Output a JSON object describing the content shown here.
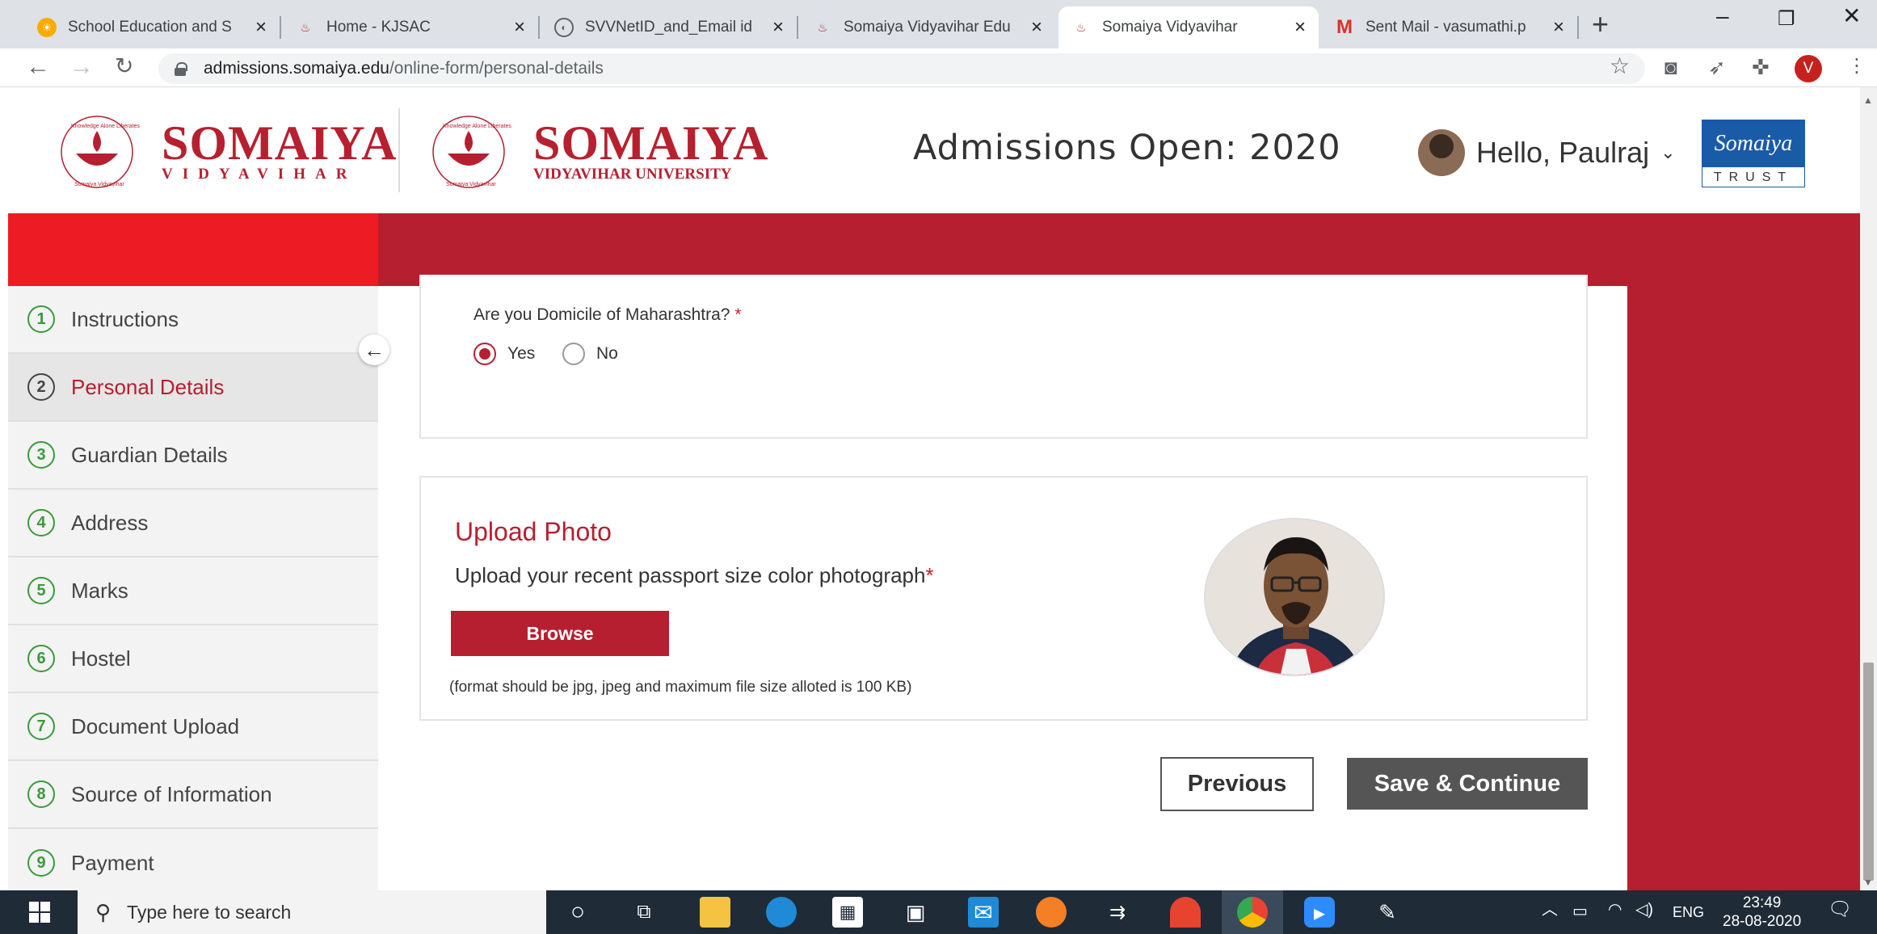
{
  "browser": {
    "tabs": [
      {
        "label": "School Education and S",
        "icon": "sun-favicon-icon",
        "color": "#f9ab00"
      },
      {
        "label": "Home - KJSAC",
        "icon": "somaiya-favicon-icon",
        "color": "#b61f30"
      },
      {
        "label": "SVVNetID_and_Email id",
        "icon": "globe-favicon-icon",
        "color": "#5f6368"
      },
      {
        "label": "Somaiya Vidyavihar Edu",
        "icon": "somaiya-favicon-icon",
        "color": "#b61f30"
      },
      {
        "label": "Somaiya Vidyavihar",
        "icon": "somaiya-favicon-icon",
        "color": "#b61f30"
      },
      {
        "label": "Sent Mail - vasumathi.p",
        "icon": "gmail-favicon-icon",
        "color": "#d93025"
      }
    ],
    "active_tab_index": 4,
    "url_host": "admissions.somaiya.edu",
    "url_path": "/online-form/personal-details",
    "profile_initial": "V"
  },
  "header": {
    "logo1": {
      "name": "SOMAIYA",
      "sub": "VIDYAVIHAR",
      "ring_top": "Knowledge Alone Liberates",
      "ring_bottom": "Somaiya Vidyavihar"
    },
    "logo2": {
      "name": "SOMAIYA",
      "sub": "VIDYAVIHAR UNIVERSITY",
      "ring_top": "Knowledge Alone Liberates",
      "ring_bottom": "Somaiya Vidyavihar"
    },
    "admissions": "Admissions Open: 2020",
    "greeting": "Hello, Paulraj",
    "trust_top": "Somaiya",
    "trust_bottom": "TRUST"
  },
  "sidebar": {
    "steps": [
      {
        "num": "1",
        "label": "Instructions"
      },
      {
        "num": "2",
        "label": "Personal Details"
      },
      {
        "num": "3",
        "label": "Guardian Details"
      },
      {
        "num": "4",
        "label": "Address"
      },
      {
        "num": "5",
        "label": "Marks"
      },
      {
        "num": "6",
        "label": "Hostel"
      },
      {
        "num": "7",
        "label": "Document Upload"
      },
      {
        "num": "8",
        "label": "Source of Information"
      },
      {
        "num": "9",
        "label": "Payment"
      }
    ],
    "active_index": 1
  },
  "form": {
    "domicile_question": "Are you Domicile of Maharashtra?",
    "required_mark": "*",
    "yes": "Yes",
    "no": "No",
    "domicile_value": "Yes",
    "upload_title": "Upload Photo",
    "upload_desc": "Upload your recent passport size color photograph",
    "browse": "Browse",
    "hint": "(format should be jpg, jpeg and maximum file size alloted is 100 KB)",
    "previous": "Previous",
    "save_continue": "Save & Continue"
  },
  "taskbar": {
    "search_placeholder": "Type here to search",
    "lang": "ENG",
    "time": "23:49",
    "date": "28-08-2020"
  },
  "colors": {
    "brand_red": "#b61f30",
    "band_red": "#ed1c24",
    "step_green": "#3a9a3a",
    "trust_blue": "#1a5ba8"
  }
}
